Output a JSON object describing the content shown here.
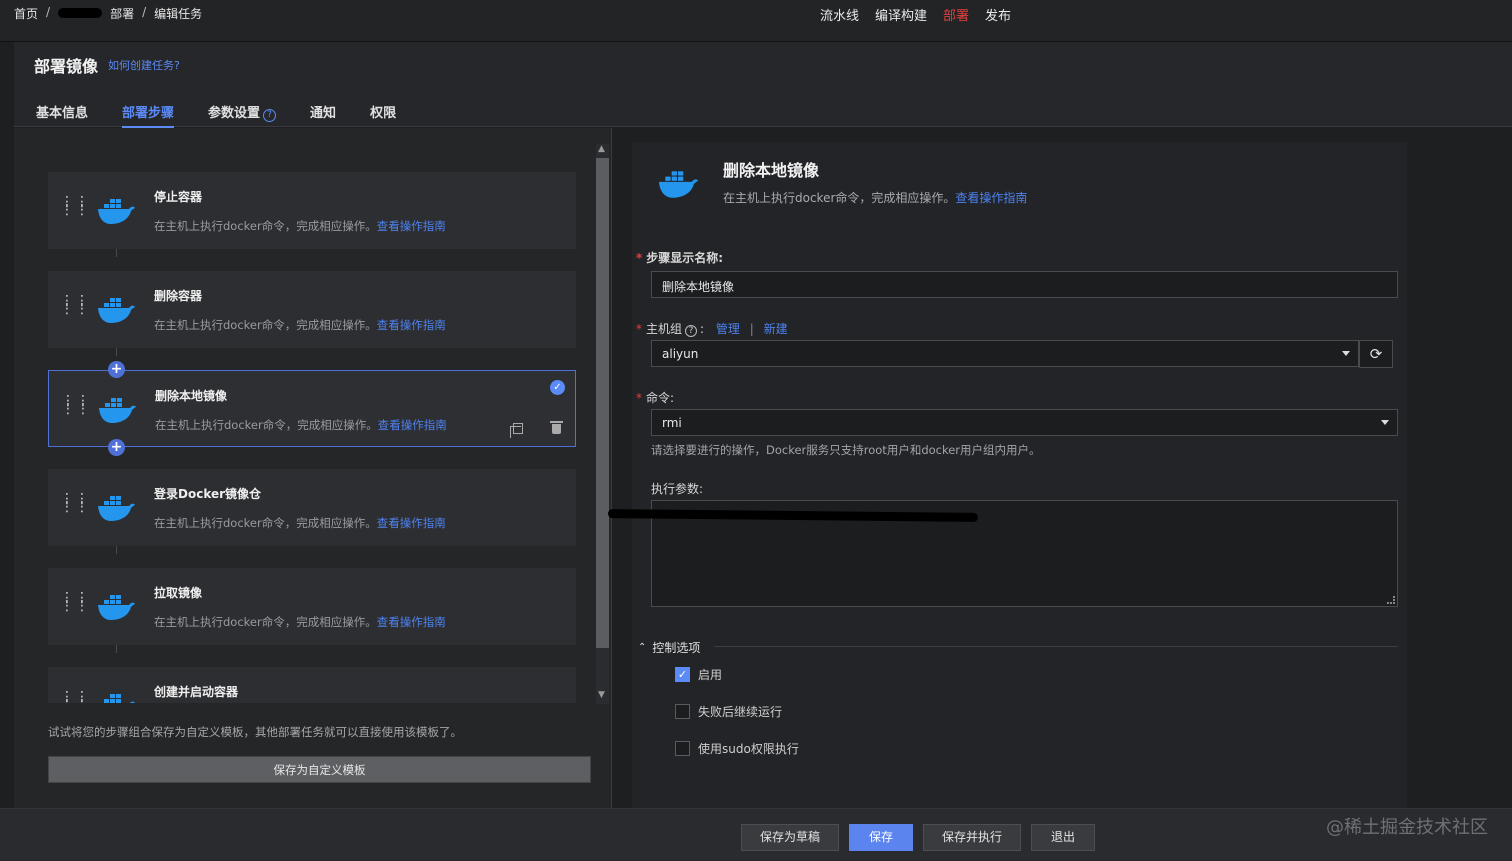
{
  "breadcrumb": {
    "home": "首页",
    "sep": "/",
    "deploy": "部署",
    "current": "编辑任务"
  },
  "pipeline_nav": [
    "流水线",
    "编译构建",
    "部署",
    "发布"
  ],
  "pipeline_active": "部署",
  "header": {
    "title": "部署镜像",
    "help_link": "如何创建任务?",
    "tabs": [
      "基本信息",
      "部署步骤",
      "参数设置",
      "通知",
      "权限"
    ],
    "active_tab": "部署步骤",
    "help_icon": "?"
  },
  "steps": {
    "items": [
      {
        "name": "停止容器",
        "desc": "在主机上执行docker命令，完成相应操作。",
        "link": "查看操作指南"
      },
      {
        "name": "删除容器",
        "desc": "在主机上执行docker命令，完成相应操作。",
        "link": "查看操作指南"
      },
      {
        "name": "删除本地镜像",
        "desc": "在主机上执行docker命令，完成相应操作。",
        "link": "查看操作指南",
        "selected": true
      },
      {
        "name": "登录Docker镜像仓",
        "desc": "在主机上执行docker命令，完成相应操作。",
        "link": "查看操作指南"
      },
      {
        "name": "拉取镜像",
        "desc": "在主机上执行docker命令，完成相应操作。",
        "link": "查看操作指南"
      },
      {
        "name": "创建并启动容器",
        "desc": "在主机上执行docker命令，完成相应操作。",
        "link": "查看操作指南"
      }
    ],
    "tip": "试试将您的步骤组合保存为自定义模板，其他部署任务就可以直接使用该模板了。",
    "save_template": "保存为自定义模板"
  },
  "detail": {
    "title": "删除本地镜像",
    "desc": "在主机上执行docker命令，完成相应操作。",
    "guide_link": "查看操作指南",
    "name_label": "步骤显示名称:",
    "name_value": "删除本地镜像",
    "host_label": "主机组",
    "host_colon": ":",
    "manage": "管理",
    "pipe": "|",
    "create": "新建",
    "host_value": "aliyun",
    "cmd_label": "命令:",
    "cmd_value": "rmi",
    "hint": "请选择要进行的操作，Docker服务只支持root用户和docker用户组内用户。",
    "params_label": "执行参数:",
    "control_title": "控制选项",
    "options": [
      "启用",
      "失败后继续运行",
      "使用sudo权限执行"
    ],
    "required_mark": "*"
  },
  "footer": {
    "draft": "保存为草稿",
    "save": "保存",
    "save_run": "保存并执行",
    "exit": "退出"
  },
  "watermark": "@稀土掘金技术社区",
  "colors": {
    "accent": "#5b8bf7",
    "active_nav": "#e2403c",
    "docker_blue": "#2496ed"
  }
}
